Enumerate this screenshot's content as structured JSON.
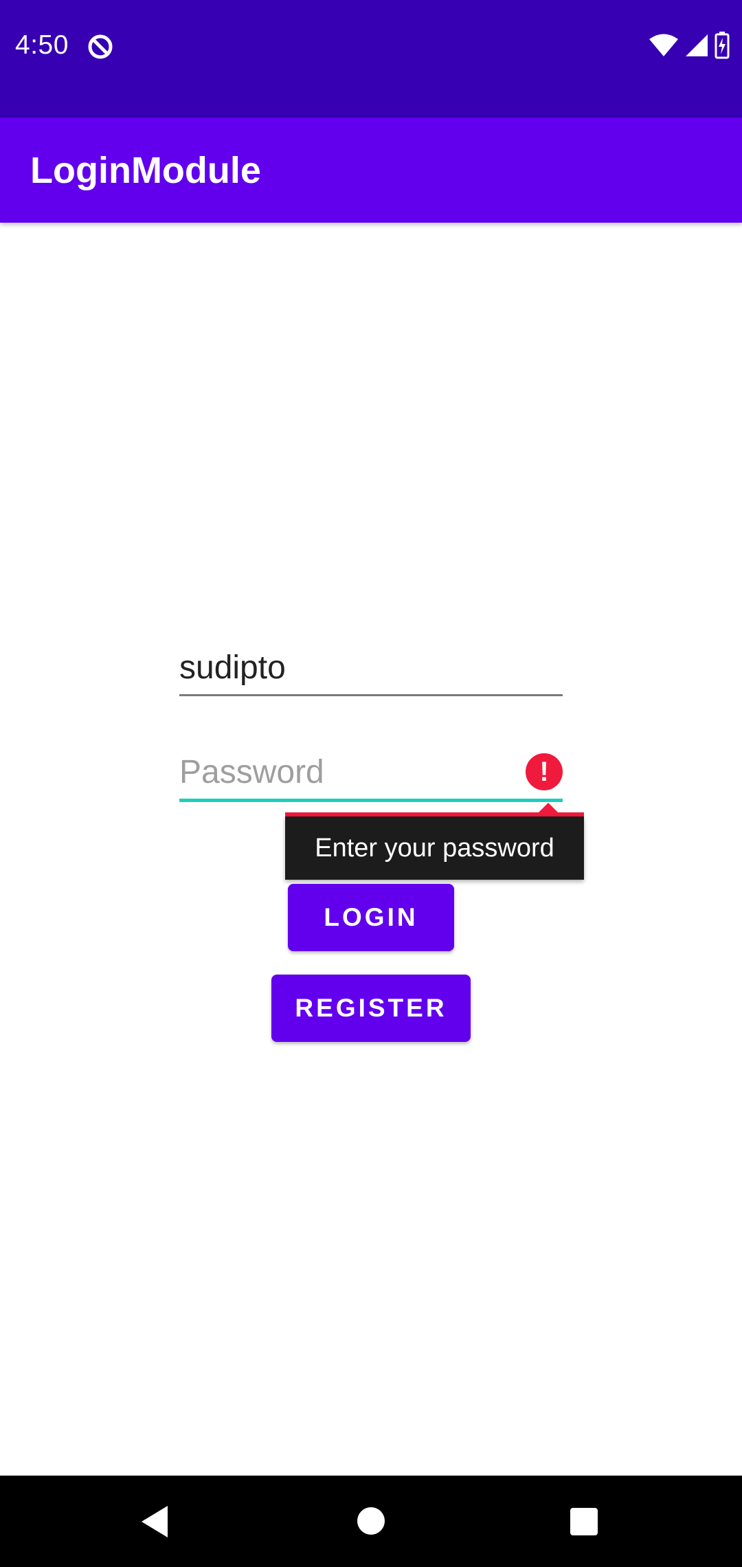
{
  "status_bar": {
    "time": "4:50"
  },
  "app_bar": {
    "title": "LoginModule"
  },
  "form": {
    "username_value": "sudipto",
    "username_placeholder": "",
    "password_value": "",
    "password_placeholder": "Password",
    "error_glyph": "!",
    "error_message": "Enter your password"
  },
  "buttons": {
    "login_label": "LOGIN",
    "register_label": "REGISTER"
  },
  "icons": {
    "status_app": "data-saver-icon",
    "wifi": "wifi-icon",
    "signal": "cell-signal-icon",
    "battery": "battery-charging-icon",
    "error": "error-icon",
    "nav_back": "back-icon",
    "nav_home": "home-icon",
    "nav_recents": "recents-icon"
  },
  "colors": {
    "status_bar": "#3700b3",
    "primary": "#6200ee",
    "accent_underline": "#1dcdbe",
    "error": "#f01a3c",
    "popup_background": "#1c1c1c"
  }
}
